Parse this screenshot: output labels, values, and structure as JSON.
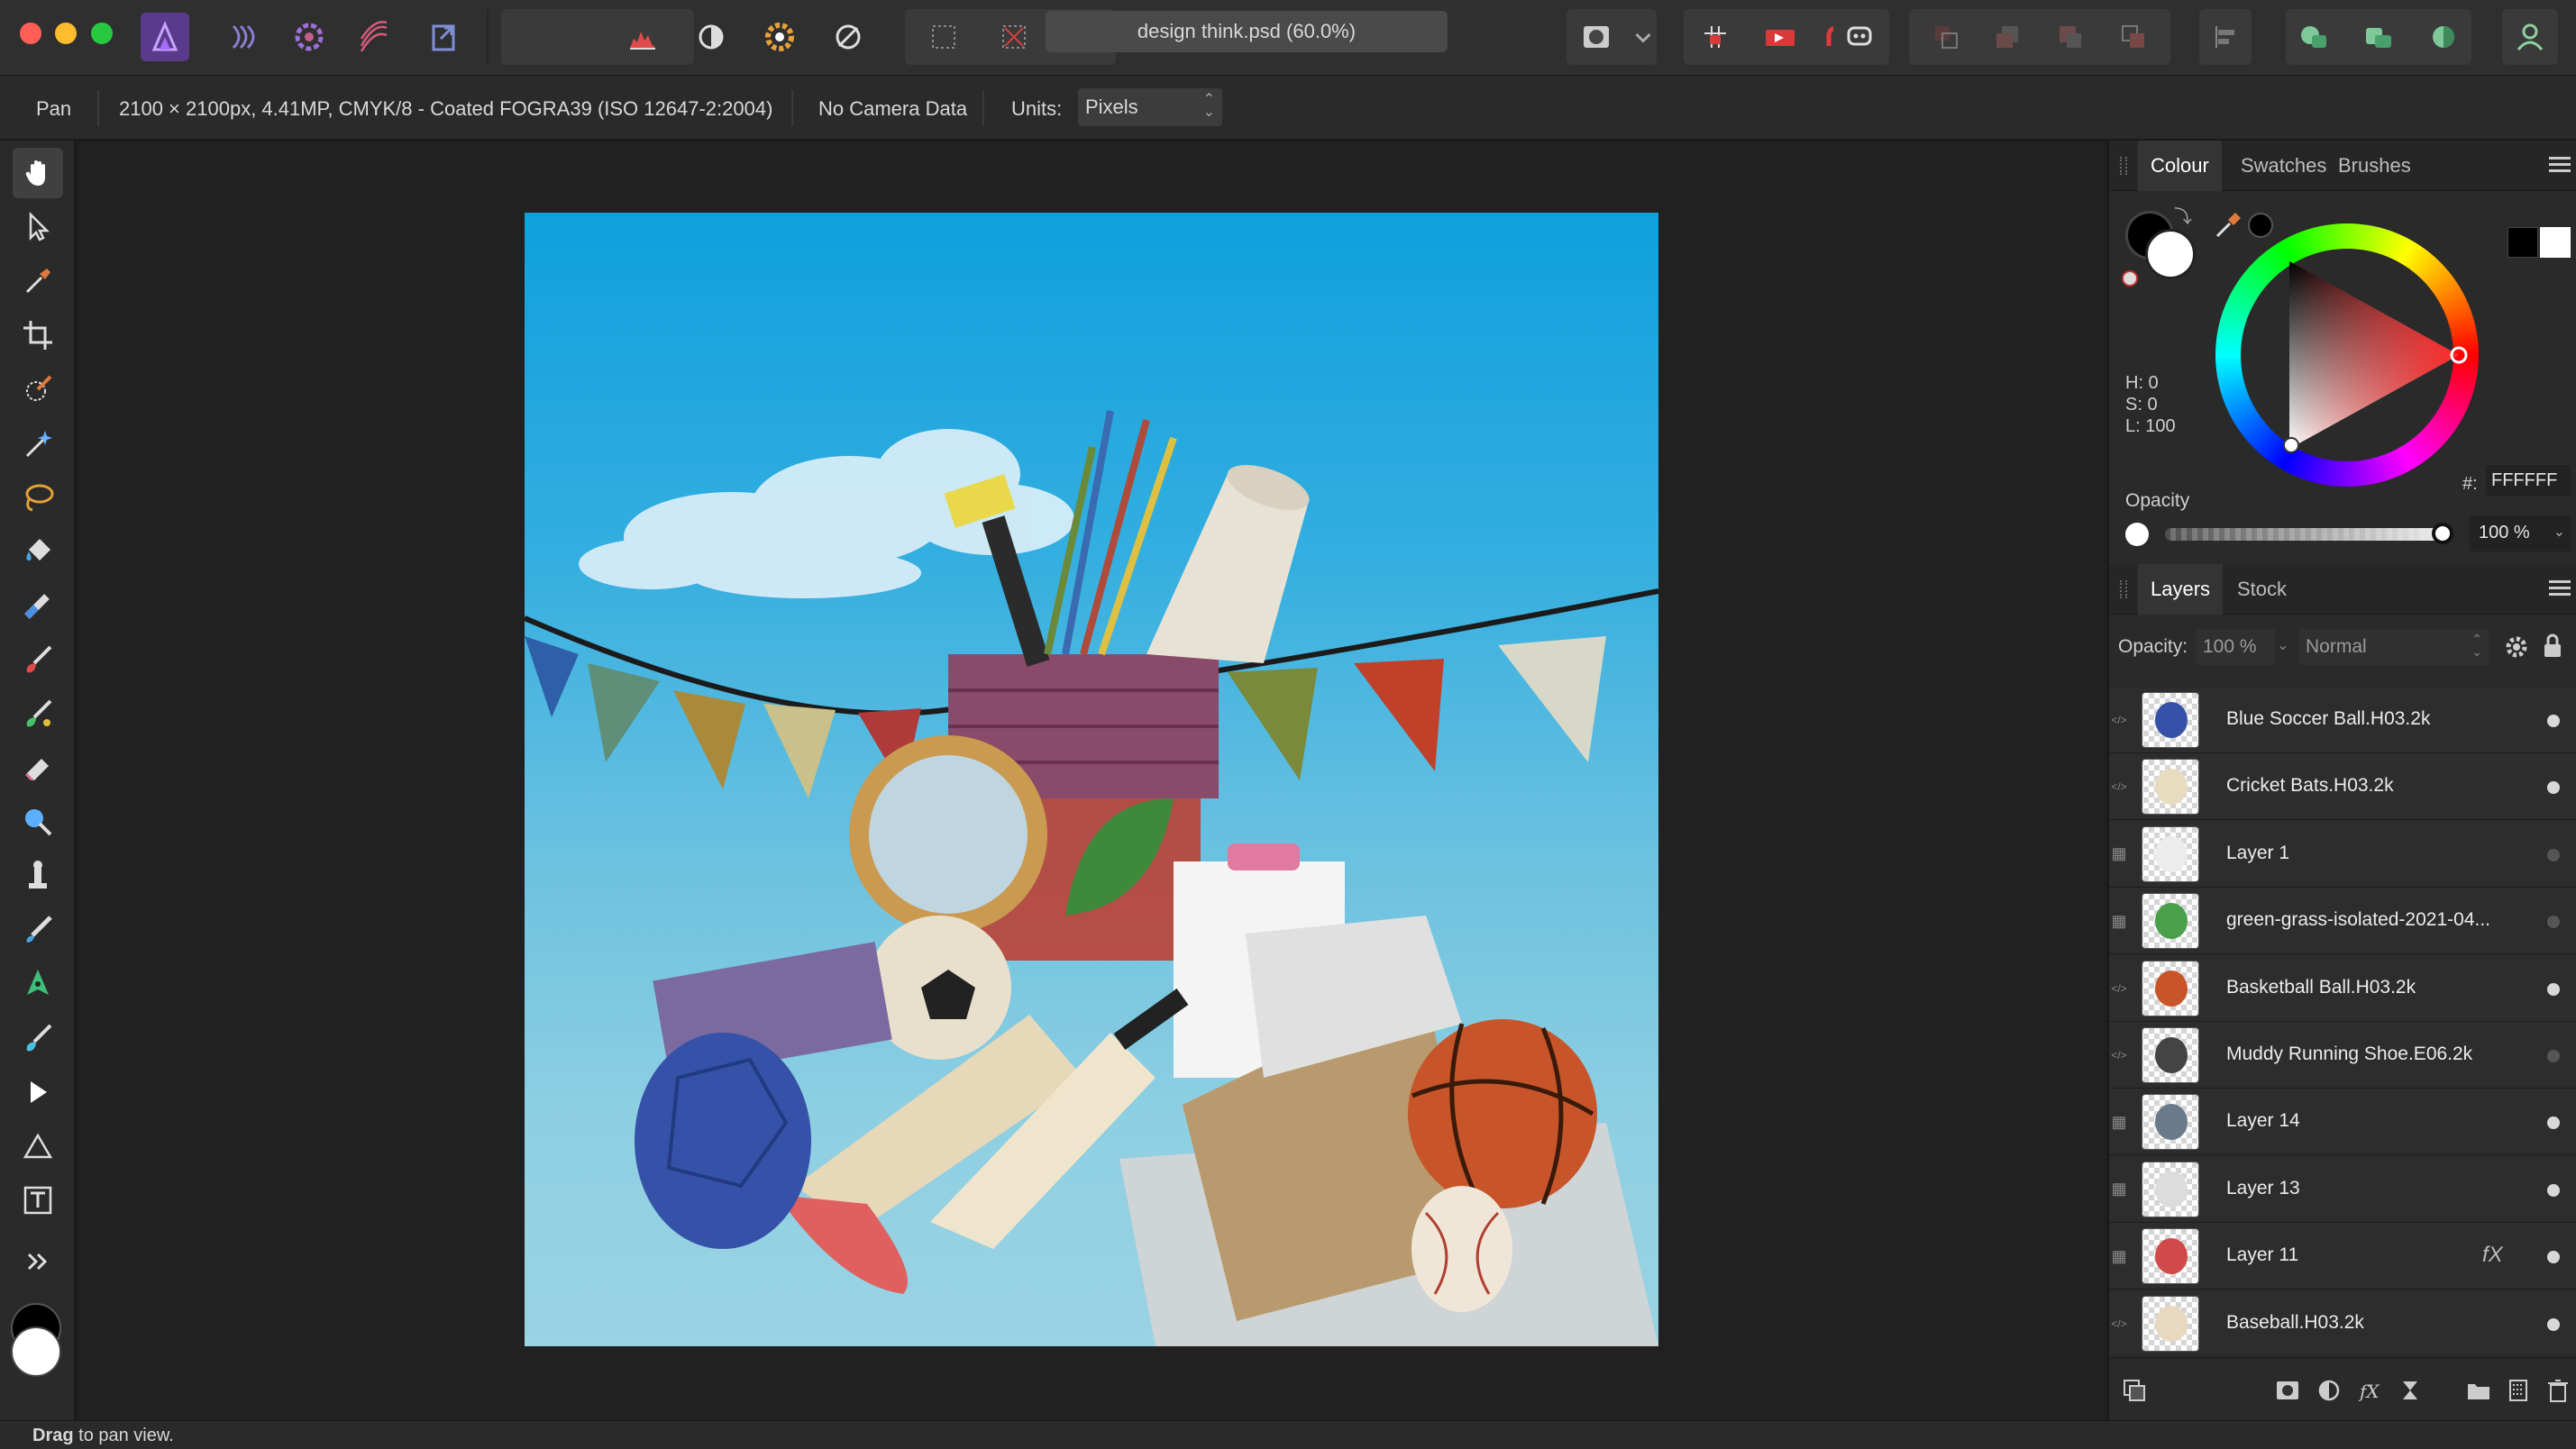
{
  "app": {
    "document_title": "design think.psd (60.0%)"
  },
  "context_bar": {
    "tool_name": "Pan",
    "doc_info": "2100 × 2100px, 4.41MP, CMYK/8 - Coated FOGRA39 (ISO 12647-2:2004)",
    "camera": "No Camera Data",
    "units_label": "Units:",
    "units_value": "Pixels"
  },
  "colour_panel": {
    "tabs": [
      "Colour",
      "Swatches",
      "Brushes"
    ],
    "active_tab": "Colour",
    "h": "H: 0",
    "s": "S: 0",
    "l": "L: 100",
    "hex_label": "#:",
    "hex_value": "FFFFFF",
    "opacity_label": "Opacity",
    "opacity_value": "100 %",
    "opacity_fraction": 1.0,
    "primary_colour": "#000000",
    "secondary_colour": "#FFFFFF"
  },
  "layers_panel": {
    "tabs": [
      "Layers",
      "Stock"
    ],
    "active_tab": "Layers",
    "opacity_label": "Opacity:",
    "opacity_value": "100 %",
    "blend_mode": "Normal",
    "layers": [
      {
        "name": "Blue Soccer Ball.H03.2k",
        "visible": true,
        "kind": "embedded"
      },
      {
        "name": "Cricket Bats.H03.2k",
        "visible": true,
        "kind": "embedded"
      },
      {
        "name": "Layer 1",
        "visible": false,
        "kind": "pixel"
      },
      {
        "name": "green-grass-isolated-2021-04...",
        "visible": false,
        "kind": "pixel"
      },
      {
        "name": "Basketball Ball.H03.2k",
        "visible": true,
        "kind": "embedded"
      },
      {
        "name": "Muddy Running Shoe.E06.2k",
        "visible": false,
        "kind": "embedded"
      },
      {
        "name": "Layer 14",
        "visible": true,
        "kind": "pixel"
      },
      {
        "name": "Layer 13",
        "visible": true,
        "kind": "pixel"
      },
      {
        "name": "Layer 11",
        "visible": true,
        "kind": "pixel",
        "fx": "fX"
      },
      {
        "name": "Baseball.H03.2k",
        "visible": true,
        "kind": "embedded"
      }
    ]
  },
  "status": {
    "bold": "Drag",
    "rest": " to pan view."
  }
}
